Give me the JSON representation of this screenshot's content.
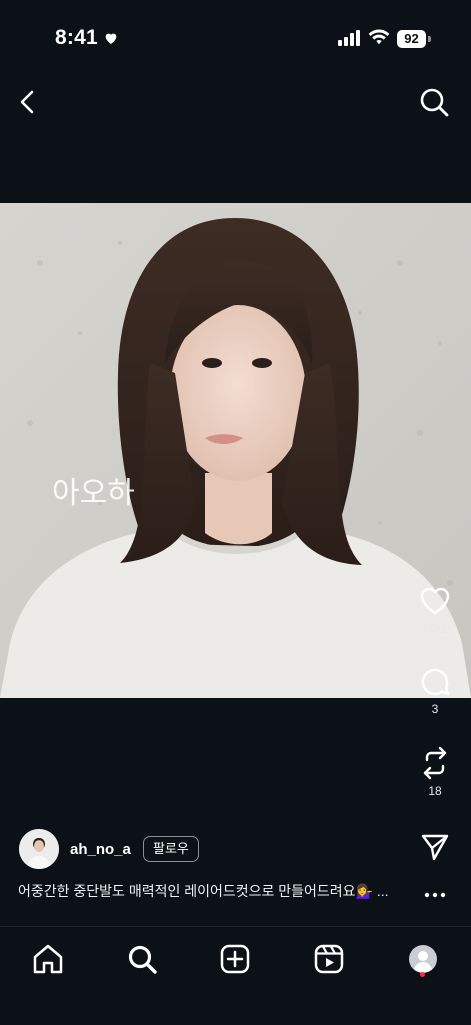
{
  "status_bar": {
    "time": "8:41",
    "battery": "92"
  },
  "post": {
    "image_overlay_text": "아오하",
    "username": "ah_no_a",
    "follow_label": "팔로우",
    "caption": "어중간한 중단발도 매력적인 레이어드컷으로 만들어드려요💁‍♀️ ..."
  },
  "actions": {
    "like_label": "좋아요",
    "comment_count": "3",
    "repost_count": "18"
  },
  "bottom_nav": {
    "items": [
      "home-icon",
      "search-icon",
      "create-icon",
      "reels-icon",
      "profile-icon"
    ],
    "notification_dot_color": "#ff2d3d"
  }
}
